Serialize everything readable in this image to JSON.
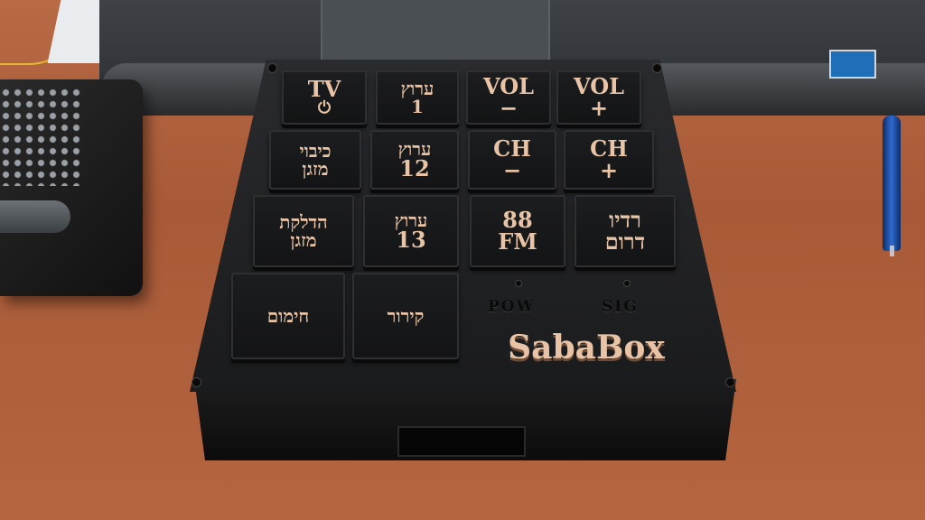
{
  "keys": [
    {
      "l1": "TV",
      "l2": "⏻"
    },
    {
      "l1": "ערוץ",
      "l2": "1"
    },
    {
      "l1": "VOL",
      "l2": "−"
    },
    {
      "l1": "VOL",
      "l2": "+"
    },
    {
      "l1": "כיבוי",
      "l2": "מזגן"
    },
    {
      "l1": "ערוץ",
      "l2": "12"
    },
    {
      "l1": "CH",
      "l2": "−"
    },
    {
      "l1": "CH",
      "l2": "+"
    },
    {
      "l1": "הדלקת",
      "l2": "מזגן"
    },
    {
      "l1": "ערוץ",
      "l2": "13"
    },
    {
      "l1": "88",
      "l2": "FM"
    },
    {
      "l1": "רדיו",
      "l2": "דרום"
    },
    {
      "l1": "חימום",
      "l2": ""
    },
    {
      "l1": "קירור",
      "l2": ""
    }
  ],
  "indicators": {
    "pow": "POW",
    "sig": "SIG"
  },
  "brand": "SabaBox",
  "colors": {
    "lettering": "#e8c3a6",
    "box": "#1a1b1d",
    "desk": "#b0603c"
  }
}
